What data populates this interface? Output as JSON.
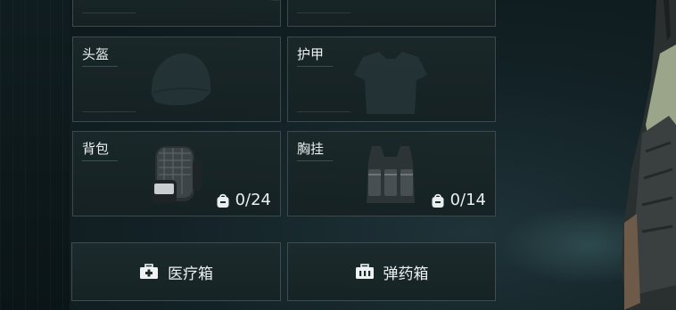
{
  "slots": {
    "helmet": {
      "label": "头盔"
    },
    "armor": {
      "label": "护甲"
    },
    "backpack": {
      "label": "背包",
      "capacity": "0/24"
    },
    "chest_rig": {
      "label": "胸挂",
      "capacity": "0/14"
    }
  },
  "buttons": {
    "medkit": {
      "label": "医疗箱",
      "icon": "medkit-icon"
    },
    "ammo": {
      "label": "弹药箱",
      "icon": "ammo-box-icon"
    }
  },
  "colors": {
    "panel_border": "#3a4a4d",
    "text": "#e9eeee",
    "background": "#132226"
  }
}
